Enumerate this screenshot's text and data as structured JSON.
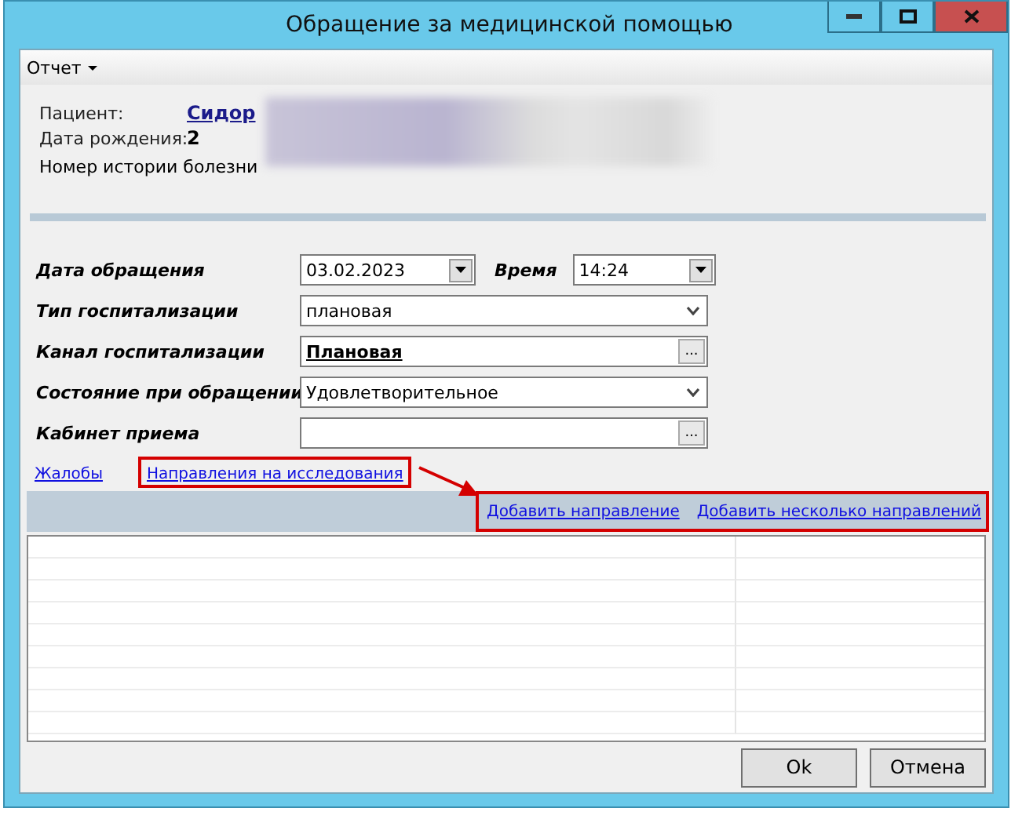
{
  "window": {
    "title": "Обращение за медицинской помощью"
  },
  "menu": [
    {
      "label": "Отчет"
    }
  ],
  "patient": {
    "name_label": "Пациент:",
    "name": "Сидор",
    "birth_label": "Дата рождения:",
    "birth": "2",
    "history_label": "Номер истории болезни"
  },
  "form": [
    {
      "kind": "datetime",
      "label": "Дата обращения",
      "value": "03.02.2023",
      "time_label": "Время",
      "time": "14:24"
    },
    {
      "kind": "combo",
      "label": "Тип госпитализации",
      "value": "плановая"
    },
    {
      "kind": "lookup",
      "label": "Канал госпитализации",
      "value": "Плановая",
      "button": "..."
    },
    {
      "kind": "combo",
      "label": "Состояние при обращении",
      "value": "Удовлетворительное"
    },
    {
      "kind": "lookup",
      "label": "Кабинет приема",
      "button": "..."
    }
  ],
  "tabs": [
    {
      "label": "Жалобы",
      "highlighted": false
    },
    {
      "label": "Направления на исследования",
      "highlighted": true
    }
  ],
  "toolbar": {
    "highlighted": true,
    "links": [
      "Добавить направление",
      "Добавить несколько направлений"
    ]
  },
  "buttons": [
    "Ok",
    "Отмена"
  ]
}
